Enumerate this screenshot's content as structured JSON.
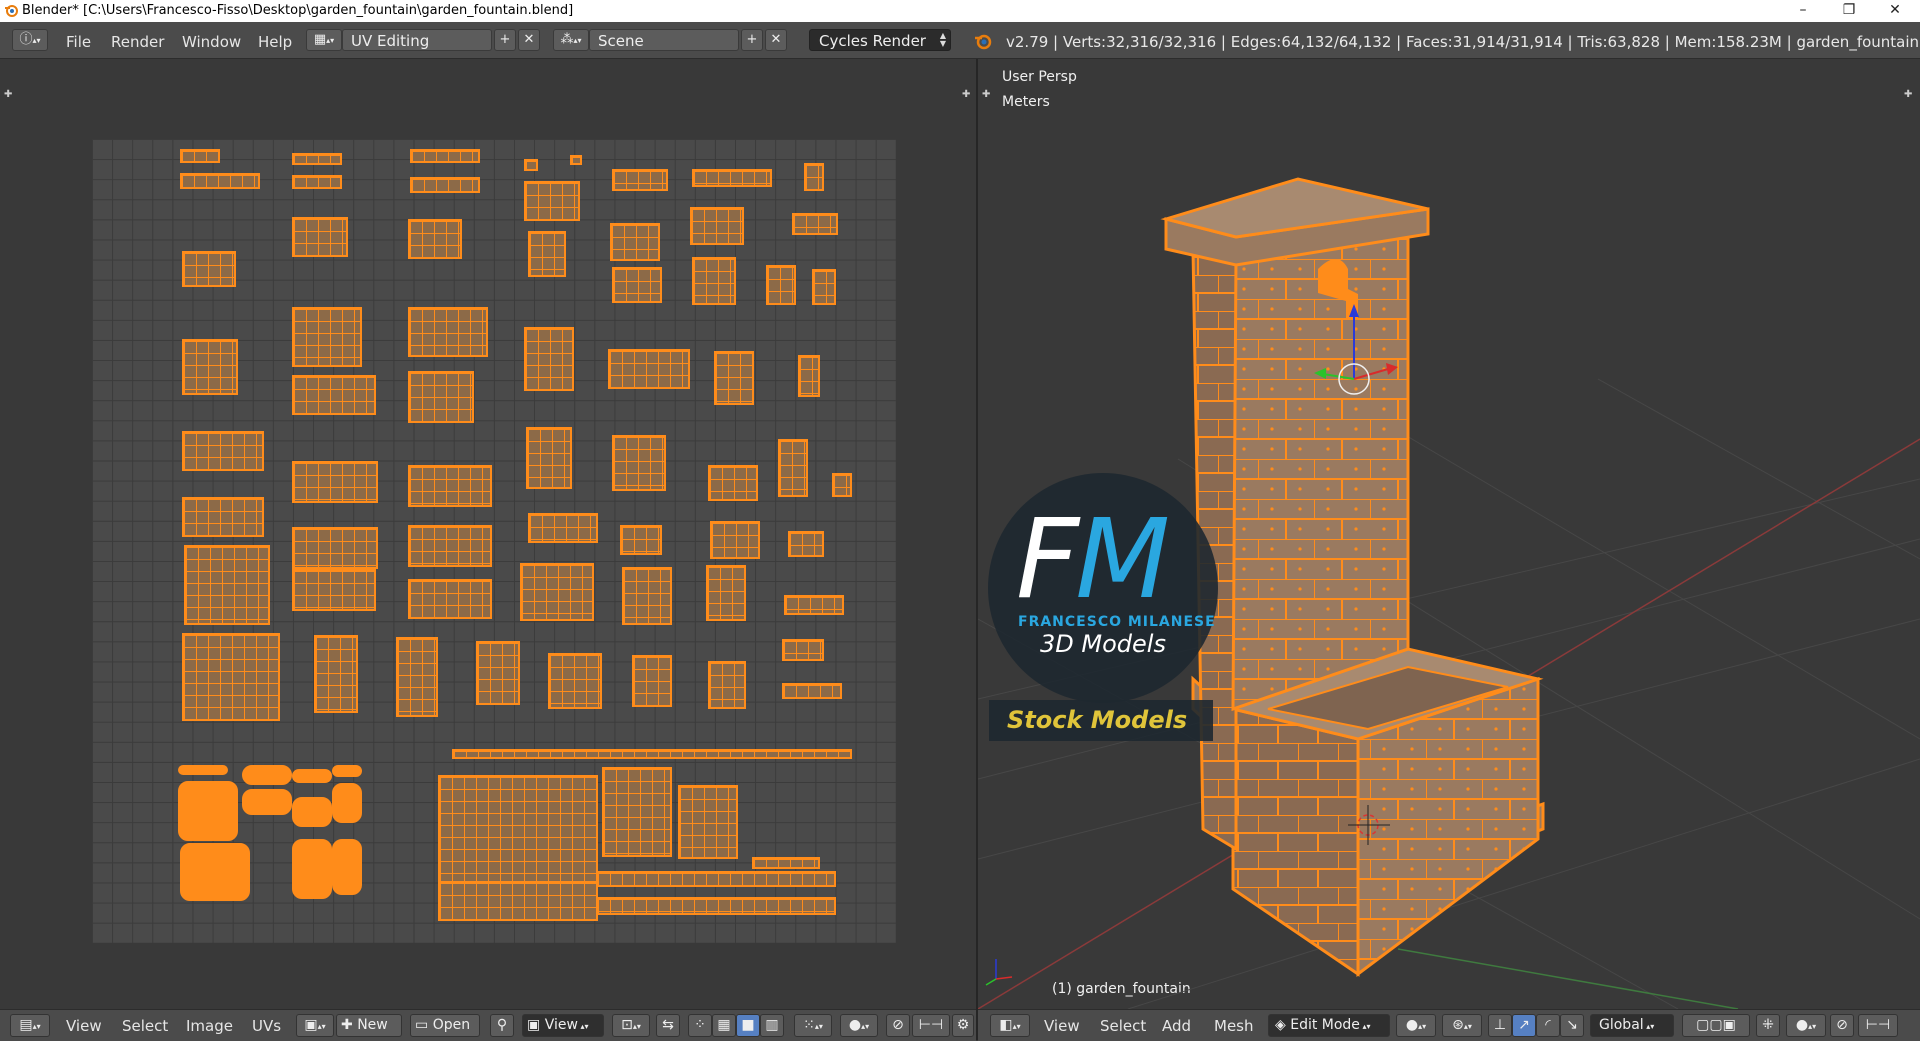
{
  "window": {
    "title": "Blender* [C:\\Users\\Francesco-Fisso\\Desktop\\garden_fountain\\garden_fountain.blend]",
    "minimize": "–",
    "maximize": "❐",
    "close": "✕"
  },
  "info_header": {
    "menus": [
      "File",
      "Render",
      "Window",
      "Help"
    ],
    "screen_layout": "UV Editing",
    "scene": "Scene",
    "render_engine": "Cycles Render",
    "stats": "v2.79 | Verts:32,316/32,316 | Edges:64,132/64,132 | Faces:31,914/31,914 | Tris:63,828 | Mem:158.23M | garden_fountain"
  },
  "uv_editor": {
    "footer": {
      "menus": [
        "View",
        "Select",
        "Image",
        "UVs"
      ],
      "new_label": "New",
      "open_label": "Open",
      "view_label": "View"
    }
  },
  "view3d": {
    "view_name": "User Persp",
    "units": "Meters",
    "object_label": "(1) garden_fountain",
    "footer": {
      "menus": [
        "View",
        "Select",
        "Add",
        "Mesh"
      ],
      "mode": "Edit Mode",
      "orientation": "Global"
    },
    "watermark": {
      "letters_f": "F",
      "letters_m": "M",
      "subtitle": "FRANCESCO MILANESE",
      "tagline": "3D Models",
      "stock": "Stock Models"
    }
  },
  "colors": {
    "selection": "#ff8c1a",
    "header": "#4b4b4b",
    "background": "#393939",
    "logo_blue": "#2aa7e0",
    "stock_yellow": "#e0c43a"
  }
}
